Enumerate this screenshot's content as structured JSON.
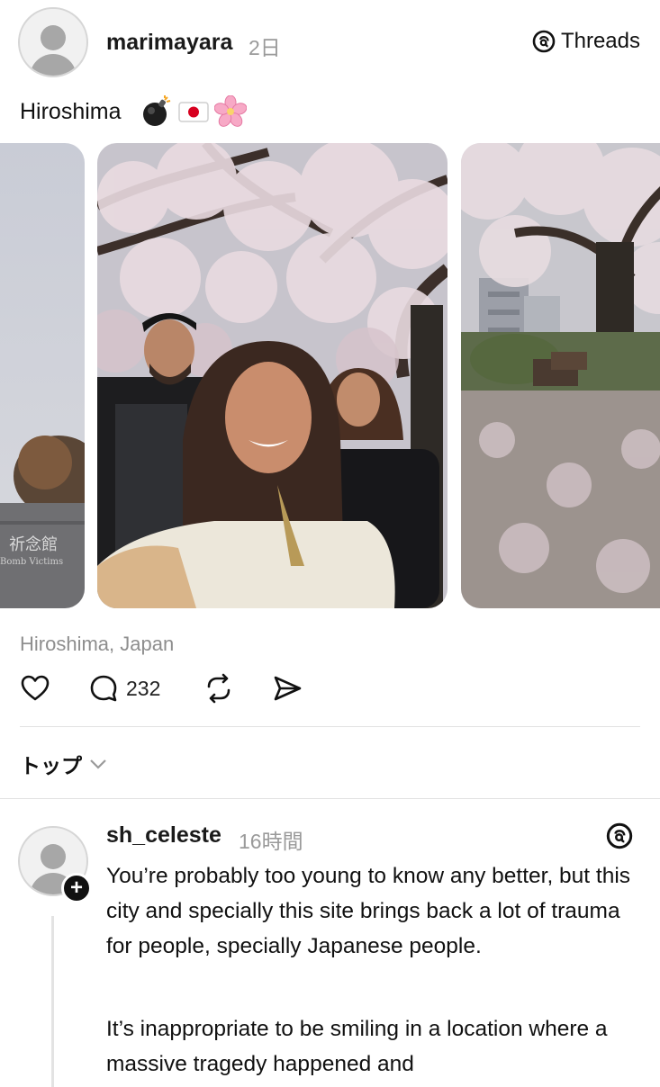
{
  "post": {
    "username": "marimayara",
    "timestamp": "2日",
    "caption": "Hiroshima",
    "caption_emojis": [
      "bomb-emoji",
      "japan-flag-emoji",
      "cherry-blossom-emoji"
    ],
    "location": "Hiroshima, Japan",
    "reply_count": "232",
    "photos": [
      "memorial-wall-photo",
      "selfie-under-cherry-blossoms-photo",
      "park-bench-cherry-trees-photo"
    ]
  },
  "header": {
    "threads_label": "Threads"
  },
  "sort": {
    "label": "トップ"
  },
  "reply": {
    "username": "sh_celeste",
    "timestamp": "16時間",
    "paragraph1": "You’re probably too young to know any better, but this city and specially this site brings back a lot of trauma for people, specially Japanese people.",
    "paragraph2": "It’s inappropriate to be smiling in a location where a massive tragedy happened and"
  },
  "colors": {
    "text": "#111111",
    "muted": "#8e8e8e",
    "divider": "#e2e2e2",
    "badge": "#111111"
  }
}
